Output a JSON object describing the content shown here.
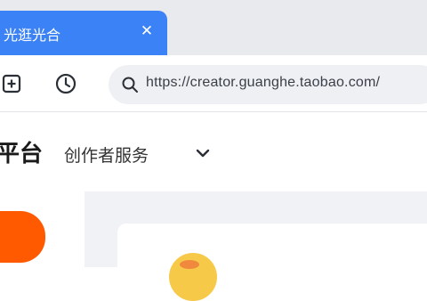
{
  "browser": {
    "tab": {
      "title": "光逛光合",
      "close_symbol": "✕"
    },
    "toolbar": {
      "new_tab_icon": "plus-square-icon",
      "history_icon": "clock-icon",
      "search_icon": "search-icon",
      "url": "https://creator.guanghe.taobao.com/"
    }
  },
  "site": {
    "brand_text": "平台",
    "nav_menu_label": "创作者服务",
    "nav_chevron_icon": "chevron-down-icon"
  },
  "colors": {
    "tab_active": "#3b82f6",
    "cta": "#ff5a00",
    "content_bg": "#f1f2f5"
  }
}
